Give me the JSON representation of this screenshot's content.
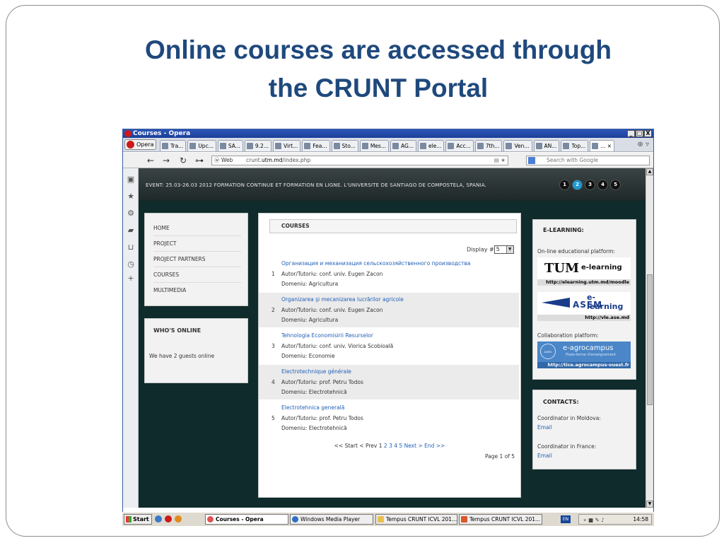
{
  "slide": {
    "title_line1": "Online courses are accessed through",
    "title_line2": "the CRUNT Portal"
  },
  "window": {
    "title": "Courses - Opera",
    "controls": [
      "_",
      "□",
      "X"
    ]
  },
  "browser": {
    "menu_label": "Opera",
    "tabs": [
      {
        "label": "Tra..."
      },
      {
        "label": "Upc..."
      },
      {
        "label": "SA..."
      },
      {
        "label": "9.2..."
      },
      {
        "label": "Virt..."
      },
      {
        "label": "Fea..."
      },
      {
        "label": "Sto..."
      },
      {
        "label": "Mes..."
      },
      {
        "label": "AG..."
      },
      {
        "label": "ele..."
      },
      {
        "label": "Acc..."
      },
      {
        "label": "7th..."
      },
      {
        "label": "Ven..."
      },
      {
        "label": "AN..."
      },
      {
        "label": "Top..."
      },
      {
        "label": "..."
      }
    ],
    "address": {
      "web_label": "Web",
      "url_prefix": "crunt.",
      "url_domain": "utm.md",
      "url_path": "/index.php"
    },
    "search_placeholder": "Search with Google"
  },
  "site": {
    "event_text": "EVENT: 25.03-26.03 2012     FORMATION CONTINUE ET FORMATION EN LIGNE. L'UNIVERSITE DE SANTIAGO DE COMPOSTELA, SPANIA.",
    "slider_pages": [
      "1",
      "2",
      "3",
      "4",
      "5"
    ],
    "slider_active": "2",
    "nav": [
      "HOME",
      "PROJECT",
      "PROJECT PARTNERS",
      "COURSES",
      "MULTIMEDIA"
    ],
    "who_online": {
      "title": "WHO'S ONLINE",
      "text": "We have 2 guests online"
    },
    "courses": {
      "header": "COURSES",
      "display_label": "Display #",
      "display_value": "5",
      "items": [
        {
          "num": "1",
          "title": "Организация и механизация сельскохозяйственного производства",
          "author": "Autor/Tutoriu: conf. univ. Eugen Zacon",
          "domain": "Domeniu: Agricultura"
        },
        {
          "num": "2",
          "title": "Organizarea şi mecanizarea lucrărilor agricole",
          "author": "Autor/Tutoriu: conf. univ. Eugen Zacon",
          "domain": "Domeniu: Agricultura"
        },
        {
          "num": "3",
          "title": "Tehnologia Economisirii Resurselor",
          "author": "Autor/Tutoriu: conf. univ. Viorica Scobioală",
          "domain": "Domeniu: Economie"
        },
        {
          "num": "4",
          "title": "Electrotechnique générale",
          "author": "Autor/Tutoriu: prof. Petru Todos",
          "domain": "Domeniu: Electrotehnică"
        },
        {
          "num": "5",
          "title": "Electrotehnica generală",
          "author": "Autor/Tutoriu: prof. Petru Todos",
          "domain": "Domeniu: Electrotehnică"
        }
      ],
      "pagination": {
        "start": "<< Start",
        "prev": "< Prev",
        "current": "1",
        "pages": [
          "2",
          "3",
          "4",
          "5"
        ],
        "next": "Next >",
        "end": "End >>"
      },
      "page_of": "Page 1 of 5"
    },
    "elearning": {
      "title": "E-LEARNING:",
      "online_label": "On-line educational platform:",
      "utm_logo": "TUM",
      "utm_el": "e-learning",
      "utm_url": "http://elearning.utm.md/moodle",
      "asem_el": "e-learning",
      "asem_name": "ASEM",
      "asem_url": "http://vle.ase.md",
      "collab_label": "Collaboration platform:",
      "agro_circle": "AGRO CAMPUS",
      "agro_name": "e-agrocampus",
      "agro_sub": "Plate-forme d'enseignement",
      "agro_url": "http://tice.agrocampus-ouest.fr"
    },
    "contacts": {
      "title": "CONTACTS:",
      "moldova_label": "Coordinator in Moldova:",
      "moldova_link": "Email",
      "france_label": "Coordinator in France:",
      "france_link": "Email"
    }
  },
  "taskbar": {
    "start": "Start",
    "items": [
      "Courses - Opera",
      "Windows Media Player",
      "Tempus CRUNT ICVL 201...",
      "Tempus CRUNT ICVL 201..."
    ],
    "lang": "EN",
    "clock": "14:58"
  }
}
